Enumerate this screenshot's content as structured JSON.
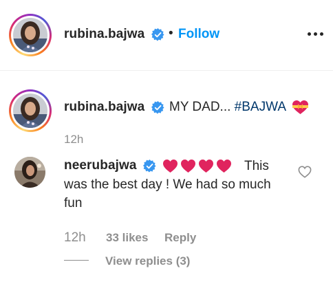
{
  "header": {
    "username": "rubina.bajwa",
    "separator": "•",
    "follow_label": "Follow",
    "more_icon": "more-options-icon"
  },
  "caption": {
    "username": "rubina.bajwa",
    "text": "MY DAD... ",
    "hashtag": "#BAJWA",
    "emoji": "heart-with-ribbon",
    "timestamp": "12h"
  },
  "comment": {
    "username": "neerubajwa",
    "emoji_hearts": 4,
    "text": "This was the best day ! We had so much fun",
    "timestamp": "12h",
    "likes": "33 likes",
    "reply_label": "Reply",
    "view_replies": "View replies (3)"
  },
  "colors": {
    "link_blue": "#0095f6",
    "hashtag": "#00376b",
    "verified": "#3897f0",
    "heart_red": "#e0245e",
    "muted": "#8e8e8e"
  }
}
